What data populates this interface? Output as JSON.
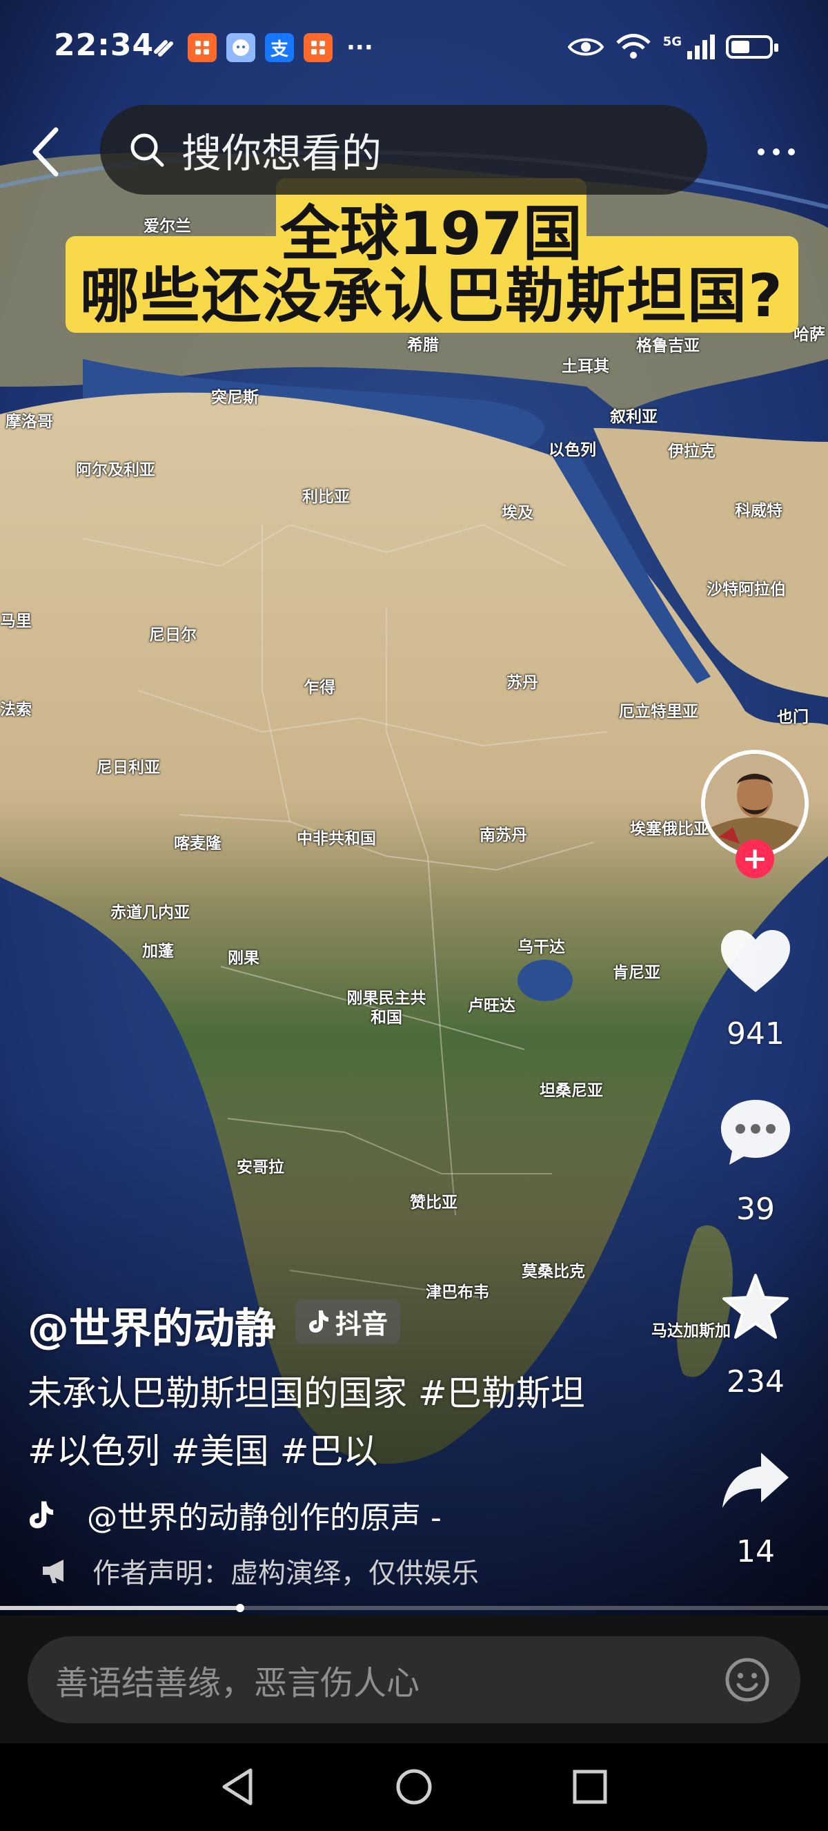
{
  "status_bar": {
    "time": "22:34",
    "apps": [
      {
        "icon": "app-icon-orange",
        "glyph": "",
        "color": "#ff6a2b"
      },
      {
        "icon": "app-icon-blue-face",
        "glyph": "",
        "color": "#5b9cff"
      },
      {
        "icon": "alipay-icon",
        "glyph": "支",
        "color": "#1677ff"
      },
      {
        "icon": "app-icon-orange",
        "glyph": "",
        "color": "#ff6a2b"
      }
    ],
    "more_dots": "···",
    "network": "5G",
    "battery_level": 0.5
  },
  "top_bar": {
    "search_placeholder": "搜你想看的"
  },
  "video": {
    "banner_line1": "全球197国",
    "banner_line2": "哪些还没承认巴勒斯坦国?",
    "map_labels": [
      "爱尔兰",
      "希腊",
      "格鲁吉亚",
      "哈萨",
      "土耳其",
      "突尼斯",
      "摩洛哥",
      "叙利亚",
      "以色列",
      "伊拉克",
      "阿尔及利亚",
      "利比亚",
      "埃及",
      "科威特",
      "沙特阿拉伯",
      "马里",
      "尼日尔",
      "乍得",
      "苏丹",
      "法索",
      "尼日利亚",
      "厄立特里亚",
      "也门",
      "喀麦隆",
      "中非共和国",
      "南苏丹",
      "埃塞俄比亚",
      "赤道几内亚",
      "加蓬",
      "刚果",
      "乌干达",
      "肯尼亚",
      "刚果民主共和国",
      "卢旺达",
      "坦桑尼亚",
      "安哥拉",
      "赞比亚",
      "莫桑比克",
      "津巴布韦",
      "马达加斯加"
    ],
    "progress": 0.29
  },
  "actions": {
    "likes": "941",
    "comments": "39",
    "favorites": "234",
    "shares": "14",
    "follow_symbol": "+"
  },
  "caption": {
    "author": "@世界的动静",
    "platform_tag": "抖音",
    "description": "未承认巴勒斯坦国的国家 #巴勒斯坦 #以色列 #美国 #巴以",
    "music": "@世界的动静创作的原声 -",
    "declaration": "作者声明：虚构演绎，仅供娱乐"
  },
  "comment_bar": {
    "placeholder": "善语结善缘，恶言伤人心"
  },
  "colors": {
    "banner": "#f7d94a",
    "follow": "#ff2c55",
    "comment_bg": "#2d2d2f"
  }
}
